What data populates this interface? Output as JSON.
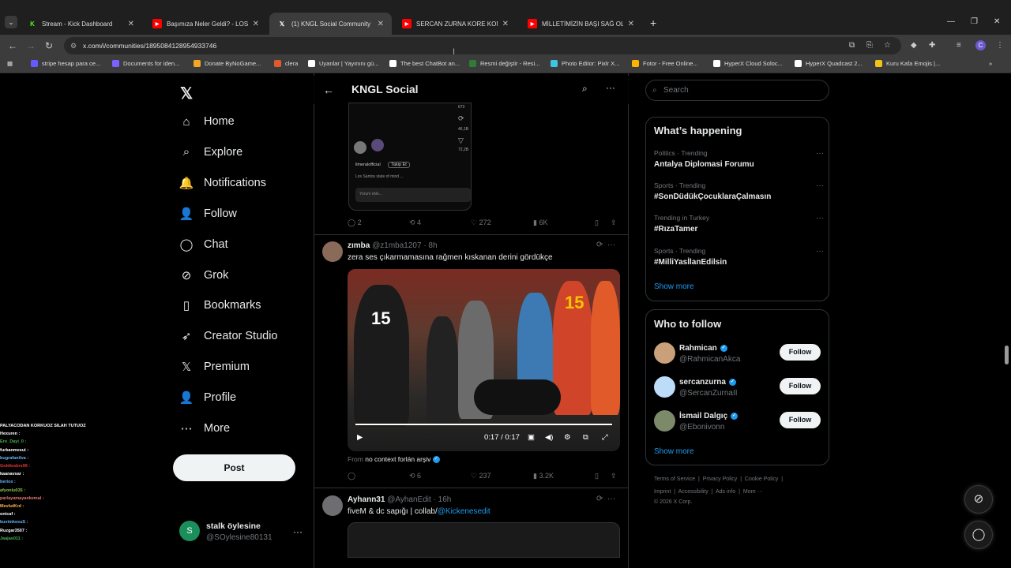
{
  "browser": {
    "tabs": [
      {
        "title": "Stream - Kick Dashboard",
        "icon": "kick-icon",
        "color": "#53fc18"
      },
      {
        "title": "Başımıza Neler Geldi? - LOS AN",
        "icon": "youtube-icon",
        "color": "#ff0000"
      },
      {
        "title": "(1) KNGL Social Community",
        "icon": "x-icon",
        "color": "#ffffff"
      },
      {
        "title": "SERCAN ZURNA KORE KOMİK A",
        "icon": "youtube-icon",
        "color": "#ff0000"
      },
      {
        "title": "MİLLETİMİZİN BAŞI SAĞ OLSUN",
        "icon": "youtube-icon",
        "color": "#ff0000"
      }
    ],
    "url": "x.com/i/communities/1895084128954933746",
    "bookmarks": [
      {
        "label": "stripe hesap para ce...",
        "color": "#635bff"
      },
      {
        "label": "Documents for iden...",
        "color": "#7b61ff"
      },
      {
        "label": "Donate ByNoGame...",
        "color": "#f5a623"
      },
      {
        "label": "clera",
        "color": "#e05a2b"
      },
      {
        "label": "Uyanlar | Yayınını gü...",
        "color": "#ffffff"
      },
      {
        "label": "The best ChatBot an...",
        "color": "#ffffff"
      },
      {
        "label": "Resmi değiştir - Resi...",
        "color": "#2e7d32"
      },
      {
        "label": "Photo Editor: Pixlr X...",
        "color": "#3ec6e0"
      },
      {
        "label": "Fotor - Free Online...",
        "color": "#ffb300"
      },
      {
        "label": "HyperX Cloud Soloc...",
        "color": "#ffffff"
      },
      {
        "label": "HyperX Quadcast 2...",
        "color": "#ffffff"
      },
      {
        "label": "Kuru Kafa Emojis |...",
        "color": "#f0c419"
      }
    ]
  },
  "sidebar": {
    "items": [
      {
        "label": "Home",
        "icon": "home-icon",
        "glyph": "⌂"
      },
      {
        "label": "Explore",
        "icon": "search-icon",
        "glyph": "⌕"
      },
      {
        "label": "Notifications",
        "icon": "bell-icon",
        "glyph": "🔔",
        "badge": "1"
      },
      {
        "label": "Follow",
        "icon": "person-add-icon",
        "glyph": "👤"
      },
      {
        "label": "Chat",
        "icon": "chat-icon",
        "glyph": "◯"
      },
      {
        "label": "Grok",
        "icon": "grok-icon",
        "glyph": "⊘"
      },
      {
        "label": "Bookmarks",
        "icon": "bookmark-icon",
        "glyph": "▯"
      },
      {
        "label": "Creator Studio",
        "icon": "rocket-icon",
        "glyph": "➶"
      },
      {
        "label": "Premium",
        "icon": "x-premium-icon",
        "glyph": "𝕏"
      },
      {
        "label": "Profile",
        "icon": "profile-icon",
        "glyph": "👤"
      },
      {
        "label": "More",
        "icon": "more-circle-icon",
        "glyph": "⋯"
      }
    ],
    "post_label": "Post",
    "account": {
      "initial": "S",
      "name": "stalk öylesine",
      "handle": "@SOylesine80131"
    }
  },
  "stream_chat": [
    {
      "text": "PALYACODAN KORKUOZ SILAH TUTUOZ",
      "color": "#ffffff"
    },
    {
      "text": "Hexuren :",
      "color": "#ffffff"
    },
    {
      "text": "Ero_Dayi_0 :",
      "color": "#4caf50"
    },
    {
      "text": "furkanmesui :",
      "color": "#ffffff"
    },
    {
      "text": "bugrafanilva :",
      "color": "#64b5f6"
    },
    {
      "text": "Goldiesbrs99 :",
      "color": "#e53935"
    },
    {
      "text": "kaanavsar :",
      "color": "#ffffff"
    },
    {
      "text": "beriox :",
      "color": "#64b5f6"
    },
    {
      "text": "afyonlu035 :",
      "color": "#8bc34a"
    },
    {
      "text": "parlayamayankemal :",
      "color": "#e57373"
    },
    {
      "text": "MevlutKrd :",
      "color": "#ffb74d"
    },
    {
      "text": "onicaf :",
      "color": "#ffffff"
    },
    {
      "text": "kuvimkesuS :",
      "color": "#64b5f6"
    },
    {
      "text": "Ruzgar3507 :",
      "color": "#ffffff"
    },
    {
      "text": "Jaajas011 :",
      "color": "#4caf50"
    }
  ],
  "feed": {
    "title": "KNGL Social",
    "quote_preview": {
      "side_counts": [
        "673",
        "46,1B",
        "72,2B"
      ],
      "user": "ilmeralofficial",
      "follow": "Takip Et",
      "caption": "Los Santos state of mind ...",
      "input_placeholder": "Yorum ekle..."
    },
    "tweet0_stats": {
      "replies": "2",
      "reposts": "4",
      "likes": "272",
      "views": "6K"
    },
    "tweet1": {
      "name": "zımba",
      "handle": "@z1mba1207",
      "time": "· 8h",
      "text": "zera ses çıkarmamasına rağmen kıskanan derini gördükçe",
      "video_time": "0:17 / 0:17",
      "from_label": "From",
      "from_name": "no context forlán arşiv",
      "stats": {
        "replies": "",
        "reposts": "6",
        "likes": "237",
        "views": "3.2K"
      }
    },
    "tweet2": {
      "name": "Ayhann31",
      "handle": "@AyhanEdit",
      "time": "· 16h",
      "text": "fiveM & dc sapığı | collab/",
      "mention": "@Kickenesedit"
    }
  },
  "right": {
    "search_placeholder": "Search",
    "whats_happening": "What’s happening",
    "trends": [
      {
        "category": "Politics · Trending",
        "name": "Antalya Diplomasi Forumu"
      },
      {
        "category": "Sports · Trending",
        "name": "#SonDüdükÇocuklaraÇalmasın"
      },
      {
        "category": "Trending in Turkey",
        "name": "#RızaTamer"
      },
      {
        "category": "Sports · Trending",
        "name": "#MilliYasİlanEdilsin"
      }
    ],
    "show_more": "Show more",
    "who_to_follow": "Who to follow",
    "follow_suggestions": [
      {
        "name": "Rahmican",
        "handle": "@RahmicanAkca",
        "button": "Follow",
        "avatar_color": "#c9a07a"
      },
      {
        "name": "sercanzurna",
        "handle": "@SercanZurnaII",
        "button": "Follow",
        "avatar_color": "#bcdcf7"
      },
      {
        "name": "İsmail Dalgıç",
        "handle": "@Ebonivonn",
        "button": "Follow",
        "avatar_color": "#7d8a6a"
      }
    ],
    "footer_links": [
      "Terms of Service",
      "Privacy Policy",
      "Cookie Policy",
      "Imprint",
      "Accessibility",
      "Ads info",
      "More ···"
    ],
    "copyright": "© 2026 X Corp."
  }
}
